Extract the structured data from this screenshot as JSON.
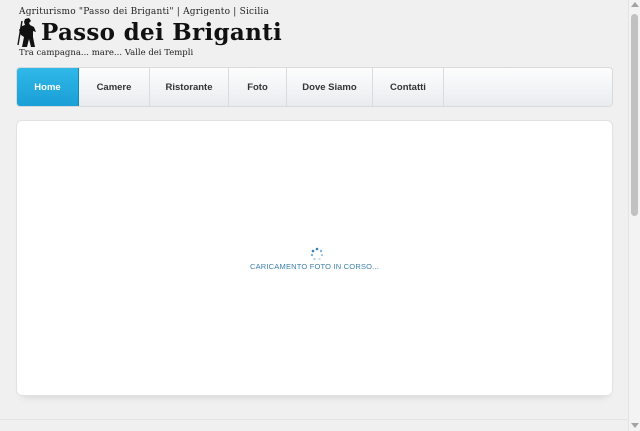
{
  "header": {
    "tagline_top": "Agriturismo \"Passo dei Briganti\" | Agrigento | Sicilia",
    "title": "Passo dei Briganti",
    "tagline_bottom": "Tra campagna... mare... Valle dei Templi",
    "logo_icon": "brigand-silhouette-icon"
  },
  "nav": {
    "items": [
      {
        "label": "Home",
        "active": true
      },
      {
        "label": "Camere",
        "active": false
      },
      {
        "label": "Ristorante",
        "active": false
      },
      {
        "label": "Foto",
        "active": false
      },
      {
        "label": "Dove Siamo",
        "active": false
      },
      {
        "label": "Contatti",
        "active": false
      }
    ],
    "active_color": "#1fa8dc"
  },
  "content": {
    "loading_text": "CARICAMENTO FOTO IN CORSO...",
    "loader_icon": "spinner-icon"
  }
}
